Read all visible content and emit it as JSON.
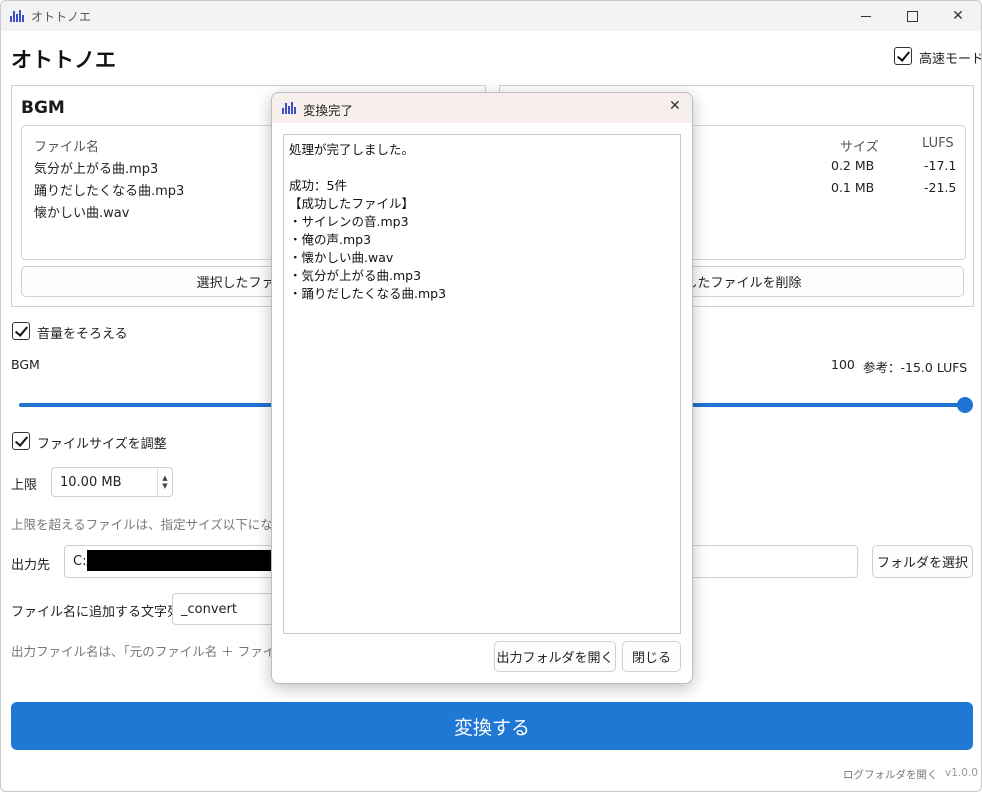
{
  "window": {
    "title": "オトトノエ",
    "controls": {
      "minimize": "minimize",
      "maximize": "maximize",
      "close": "✕"
    }
  },
  "app": {
    "heading": "オトトノエ",
    "fast_mode_label": "高速モード",
    "fast_mode_checked": true
  },
  "bgm_panel": {
    "title": "BGM",
    "columns": [
      "ファイル名"
    ],
    "files": [
      "気分が上がる曲.mp3",
      "踊りだしたくなる曲.mp3",
      "懐かしい曲.wav"
    ],
    "delete_button": "選択したファイル"
  },
  "se_panel": {
    "columns": [
      "サイズ",
      "LUFS"
    ],
    "rows": [
      {
        "size": "0.2 MB",
        "lufs": "-17.1"
      },
      {
        "size": "0.1 MB",
        "lufs": "-21.5"
      }
    ],
    "delete_button": "択したファイルを削除"
  },
  "volume": {
    "checkbox_label": "音量をそろえる",
    "checked": true,
    "bgm_label": "BGM",
    "value": "100",
    "reference": "参考：-15.0 LUFS",
    "slider_fraction": 1.0
  },
  "filesize": {
    "checkbox_label": "ファイルサイズを調整",
    "checked": true,
    "limit_label": "上限",
    "limit_value": "10.00 MB",
    "hint": "上限を超えるファイルは、指定サイズ以下になるよう自"
  },
  "output": {
    "label": "出力先",
    "path_value": "C:/",
    "browse_button": "フォルダを選択"
  },
  "suffix": {
    "label": "ファイル名に追加する文字列",
    "value": "_convert",
    "hint": "出力ファイル名は、「元のファイル名 ＋ ファイル名に追"
  },
  "convert_button": "変換する",
  "footer": {
    "log_link": "ログフォルダを開く",
    "version": "v1.0.0"
  },
  "dialog": {
    "title": "変換完了",
    "close_glyph": "✕",
    "message_lines": [
      "処理が完了しました。",
      "",
      "成功：5件",
      "【成功したファイル】",
      "・サイレンの音.mp3",
      "・俺の声.mp3",
      "・懐かしい曲.wav",
      "・気分が上がる曲.mp3",
      "・踊りだしたくなる曲.mp3"
    ],
    "open_folder_button": "出力フォルダを開く",
    "close_button": "閉じる"
  },
  "colors": {
    "accent": "#1f78d4",
    "dialog_titlebar": "#f7efec",
    "icon": "#3f4fc9"
  }
}
